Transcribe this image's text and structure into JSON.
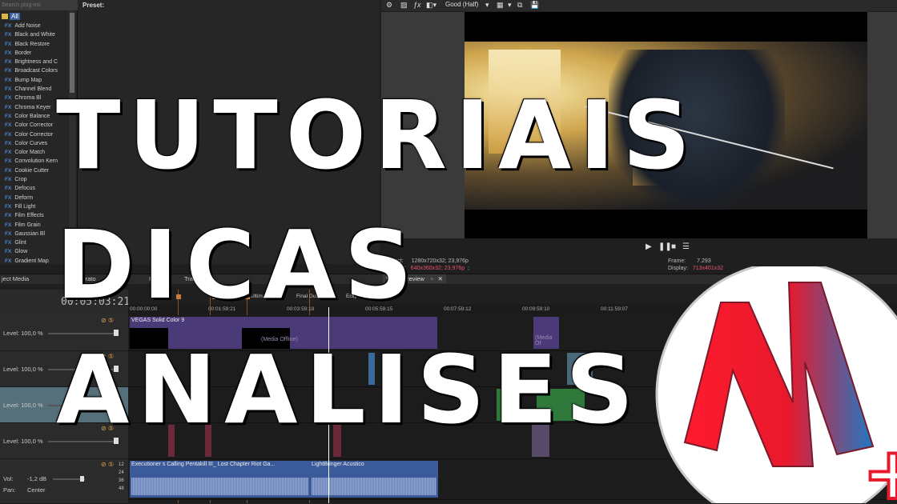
{
  "plugins": {
    "search_placeholder": "Search plug-ins",
    "root_label": "All",
    "items": [
      "Add Noise",
      "Black and White",
      "Black Restore",
      "Border",
      "Brightness and C",
      "Broadcast Colors",
      "Bump Map",
      "Channel Blend",
      "Chroma Bl",
      "Chroma Keyer",
      "Color Balance",
      "Color Corrector",
      "Color Corrector",
      "Color Curves",
      "Color Match",
      "Convolution Kern",
      "Cookie Cutter",
      "Crop",
      "Defocus",
      "Deform",
      "Fill Light",
      "Film Effects",
      "Film Grain",
      "Gaussian Bl",
      "Glint",
      "Glow",
      "Gradient Map"
    ],
    "fx_tag": "FX"
  },
  "preset": {
    "label": "Preset:"
  },
  "preview": {
    "quality": "Good (Half)",
    "project_label": "Project:",
    "project_value": "1280x720x32; 23,976p",
    "preview_label": "Preview:",
    "preview_value": "640x360x32; 23,976p",
    "display_label": "Display:",
    "display_value": "713x401x32",
    "frame_label": "Frame:",
    "frame_value": "7.293",
    "tab_label": "Video Preview"
  },
  "tabs": [
    "ject Media",
    "a Generato",
    "FX",
    "Transitions"
  ],
  "timeline": {
    "timecode": "00:05:03:21",
    "ruler": [
      "00:00:00:00",
      "00:01:59:21",
      "00:03:59:18",
      "00:05:59:15",
      "00:07:59:12",
      "00:09:59:10",
      "00:11:59:07"
    ],
    "markers": [
      "Flas",
      "Ultima Luta G",
      "Final Gus",
      "Eclipse"
    ],
    "tracks": [
      {
        "level": "Level: 100,0 %"
      },
      {
        "level": "Level: 100,0 %"
      },
      {
        "level": "Level: 100,0 %"
      },
      {
        "level": "Level: 100,0 %"
      }
    ],
    "audio": {
      "vol_label": "Vol:",
      "vol_value": "-1,2 dB",
      "pan_label": "Pan:",
      "pan_value": "Center",
      "meters": [
        "12",
        "24",
        "36",
        "48"
      ]
    },
    "clips": {
      "solid": "VEGAS Solid Color 9",
      "offline": "(Media Offline)",
      "offline_short": "(Media Of",
      "clip_k": "(K",
      "audio1": "Executioner s Calling Pentakill III_ Lost Chapter Riot Ga...",
      "audio2": "LightBringer Acustico"
    }
  },
  "overlay": {
    "title_1": "TUTORIAIS",
    "title_2": "DICAS",
    "title_3": "ANALISES",
    "logo_letter": "N",
    "logo_plus": "+"
  },
  "colors": {
    "accent": "#e8556b",
    "logo_red": "#e8192c",
    "logo_blue": "#1f79c4",
    "clip_purple": "#4b3a78",
    "audio_blue": "#3b5a9a"
  }
}
